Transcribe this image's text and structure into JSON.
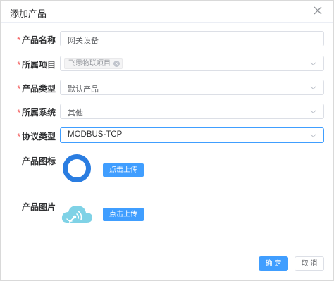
{
  "dialog": {
    "title": "添加产品",
    "close_icon": "close-icon"
  },
  "form": {
    "required_mark": "*",
    "name": {
      "label": "产品名称",
      "value": "网关设备"
    },
    "project": {
      "label": "所属项目",
      "tag": "飞思物联项目",
      "tag_close": "×"
    },
    "type": {
      "label": "产品类型",
      "value": "默认产品"
    },
    "system": {
      "label": "所属系统",
      "value": "其他"
    },
    "protocol": {
      "label": "协议类型",
      "value": "MODBUS-TCP"
    },
    "icon": {
      "label": "产品图标",
      "upload_label": "点击上传"
    },
    "image": {
      "label": "产品图片",
      "upload_label": "点击上传"
    }
  },
  "footer": {
    "ok_label": "确 定",
    "cancel_label": "取 消"
  },
  "colors": {
    "primary": "#409eff",
    "required": "#f56c6c",
    "icon_ring": "#2a7de1"
  }
}
